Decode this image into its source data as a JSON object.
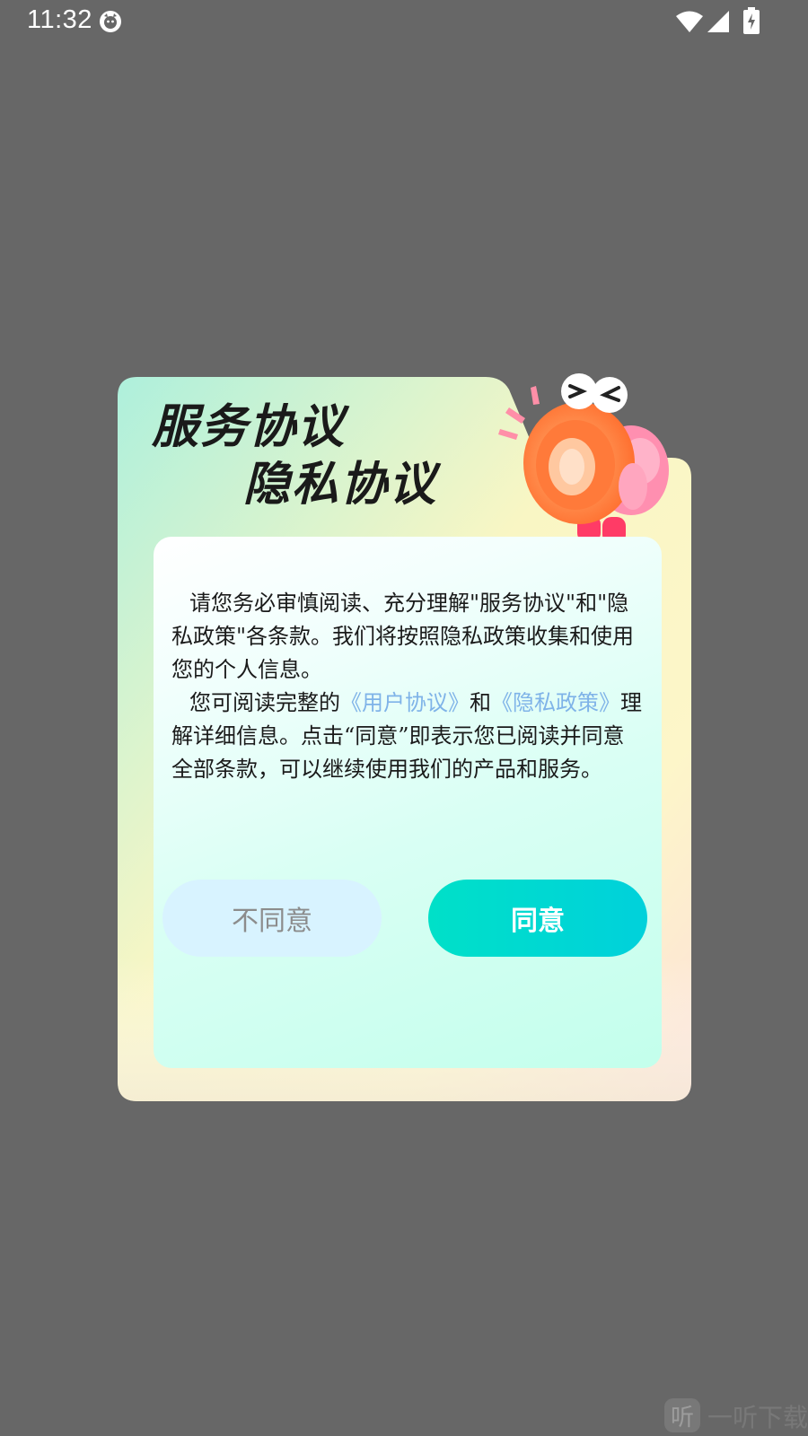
{
  "status_bar": {
    "time": "11:32",
    "icons": [
      "app-notification-icon",
      "wifi-icon",
      "signal-icon",
      "battery-charging-icon"
    ]
  },
  "dialog": {
    "title_line1": "服务协议",
    "title_line2": "隐私协议",
    "mascot": "megaphone-mascot-icon",
    "body": {
      "p1": "请您务必审慎阅读、充分理解\"服务协议\"和\"隐私政策\"各条款。我们将按照隐私政策收集和使用您的个人信息。",
      "p2_prefix": "您可阅读完整的",
      "link_user_agreement": "《用户协议》",
      "p2_and": "和",
      "link_privacy_policy": "《隐私政策》",
      "p2_suffix": "理解详细信息。点击“同意”即表示您已阅读并同意全部条款，可以继续使用我们的产品和服务。"
    },
    "buttons": {
      "disagree": "不同意",
      "agree": "同意"
    }
  },
  "watermark": {
    "icon": "听",
    "text": "一听下载"
  },
  "colors": {
    "overlay": "#676767",
    "link": "#7fb3e8",
    "agree_button": "#00d9d0",
    "disagree_button": "#d8f3ff"
  }
}
